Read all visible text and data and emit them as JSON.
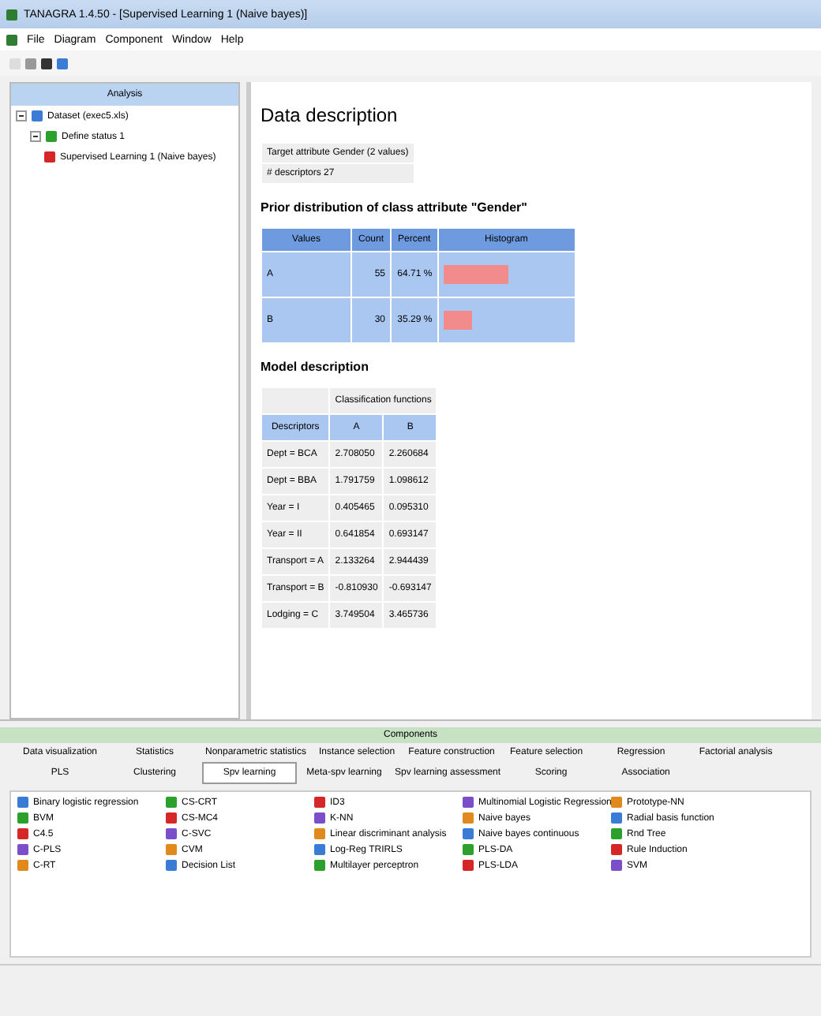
{
  "window": {
    "title": "TANAGRA 1.4.50 - [Supervised Learning 1 (Naive bayes)]"
  },
  "menu": [
    "File",
    "Diagram",
    "Component",
    "Window",
    "Help"
  ],
  "tree": {
    "title": "Analysis",
    "items": [
      {
        "label": "Dataset (exec5.xls)",
        "expanded": true,
        "children": [
          {
            "label": "Define status 1",
            "expanded": true,
            "children": [
              {
                "label": "Supervised Learning 1 (Naive bayes)"
              }
            ]
          }
        ]
      }
    ]
  },
  "report": {
    "title": "Data description",
    "info": [
      {
        "label": "Target attribute",
        "value": "Gender (2 values)"
      },
      {
        "label": "# descriptors",
        "value": "27"
      }
    ],
    "prior_title": "Prior distribution of class attribute \"Gender\"",
    "prior_columns": [
      "Values",
      "Count",
      "Percent",
      "Histogram"
    ],
    "prior_rows": [
      {
        "value": "A",
        "count": "55",
        "percent": "64.71 %",
        "level": 0.51
      },
      {
        "value": "B",
        "count": "30",
        "percent": "35.29 %",
        "level": 0.23
      }
    ],
    "model_title": "Model description",
    "model_group": "Classification functions",
    "model_columns": [
      "Descriptors",
      "A",
      "B"
    ],
    "model_rows": [
      [
        "Dept = BCA",
        "2.708050",
        "2.260684"
      ],
      [
        "Dept = BBA",
        "1.791759",
        "1.098612"
      ],
      [
        "Year = I",
        "0.405465",
        "0.095310"
      ],
      [
        "Year = II",
        "0.641854",
        "0.693147"
      ],
      [
        "Transport = A",
        "2.133264",
        "2.944439"
      ],
      [
        "Transport = B",
        "-0.810930",
        "-0.693147"
      ],
      [
        "Lodging = C",
        "3.749504",
        "3.465736"
      ]
    ]
  },
  "components": {
    "title": "Components",
    "tabs": [
      [
        {
          "label": "Data visualization",
          "selected": false
        },
        {
          "label": "Statistics",
          "selected": false
        },
        {
          "label": "Nonparametric statistics",
          "selected": false
        },
        {
          "label": "Instance selection",
          "selected": false
        },
        {
          "label": "Feature construction",
          "selected": false
        },
        {
          "label": "Feature selection",
          "selected": false
        },
        {
          "label": "Regression",
          "selected": false
        },
        {
          "label": "Factorial analysis",
          "selected": false
        }
      ],
      [
        {
          "label": "PLS",
          "selected": false
        },
        {
          "label": "Clustering",
          "selected": false
        },
        {
          "label": "Spv learning",
          "selected": true
        },
        {
          "label": "Meta-spv learning",
          "selected": false
        },
        {
          "label": "Spv learning assessment",
          "selected": false
        },
        {
          "label": "Scoring",
          "selected": false
        },
        {
          "label": "Association",
          "selected": false
        }
      ]
    ],
    "items": [
      [
        "Binary logistic regression",
        "BVM",
        "C4.5",
        "C-PLS",
        "C-RT"
      ],
      [
        "CS-CRT",
        "CS-MC4",
        "C-SVC",
        "CVM",
        "Decision List"
      ],
      [
        "ID3",
        "K-NN",
        "Linear discriminant analysis",
        "Log-Reg TRIRLS",
        "Multilayer perceptron"
      ],
      [
        "Multinomial Logistic Regression",
        "Naive bayes",
        "Naive bayes continuous",
        "PLS-DA",
        "PLS-LDA"
      ],
      [
        "Prototype-NN",
        "Radial basis function",
        "Rnd Tree",
        "Rule Induction",
        "SVM"
      ]
    ]
  }
}
